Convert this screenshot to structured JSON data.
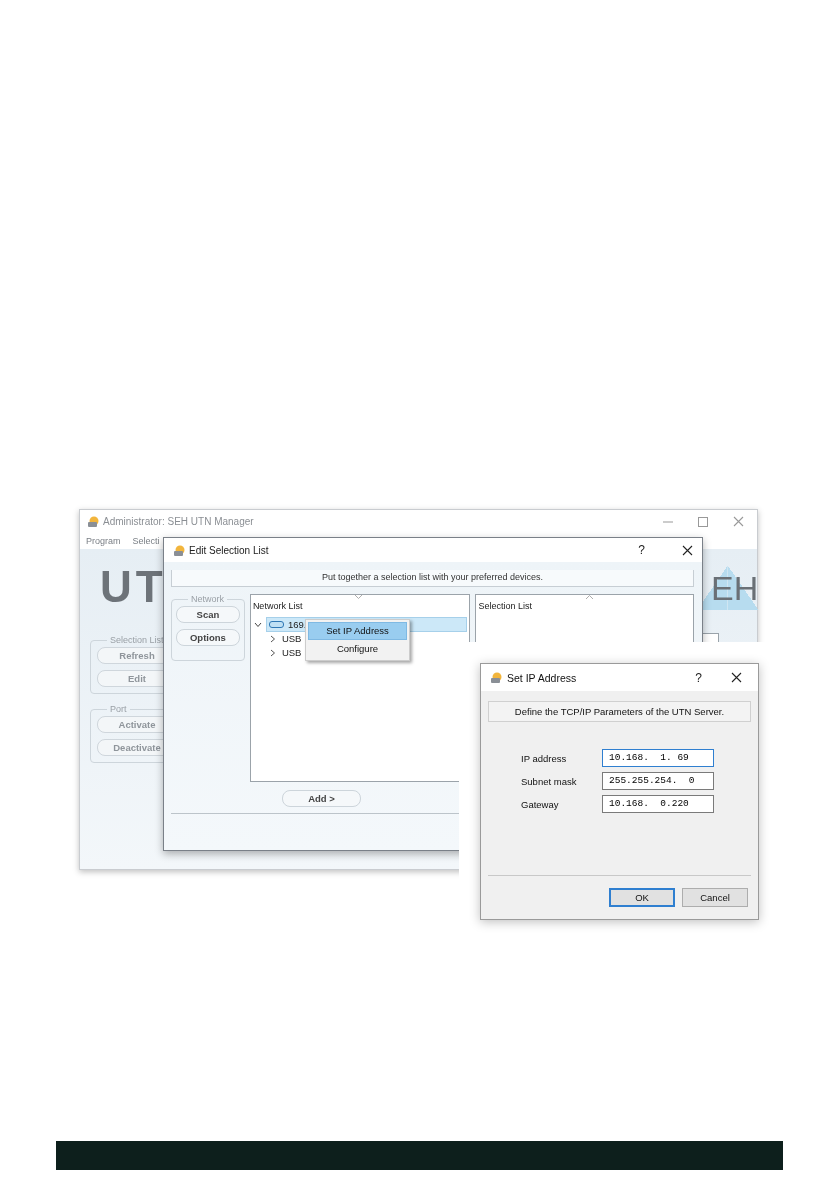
{
  "main_window": {
    "title": "Administrator: SEH UTN Manager",
    "menu": [
      "Program",
      "Selecti"
    ],
    "logo_left": "UT",
    "logo_right": "EH",
    "groups": [
      {
        "legend": "Selection List",
        "buttons": [
          "Refresh",
          "Edit"
        ]
      },
      {
        "legend": "Port",
        "buttons": [
          "Activate",
          "Deactivate"
        ]
      }
    ]
  },
  "edit_dialog": {
    "title": "Edit Selection List",
    "help": "?",
    "intro": "Put together a selection list with your preferred devices.",
    "network_group": {
      "legend": "Network",
      "buttons": [
        "Scan",
        "Options"
      ]
    },
    "network_list": {
      "heading": "Network List",
      "items": [
        {
          "label": "169.",
          "kind": "device",
          "expanded": true,
          "selected": true
        },
        {
          "label": "USB",
          "kind": "port",
          "expanded": false,
          "selected": false
        },
        {
          "label": "USB",
          "kind": "port",
          "expanded": false,
          "selected": false
        }
      ]
    },
    "selection_list": {
      "heading": "Selection List"
    },
    "add_button": "Add >"
  },
  "context_menu": {
    "items": [
      {
        "label": "Set IP Address",
        "selected": true
      },
      {
        "label": "Configure",
        "selected": false
      }
    ]
  },
  "ip_dialog": {
    "title": "Set IP Address",
    "help": "?",
    "intro": "Define the TCP/IP Parameters of the UTN Server.",
    "fields": [
      {
        "label": "IP address",
        "value": "10.168.  1. 69",
        "focused": true
      },
      {
        "label": "Subnet mask",
        "value": "255.255.254.  0",
        "focused": false
      },
      {
        "label": "Gateway",
        "value": "10.168.  0.220",
        "focused": false
      }
    ],
    "buttons": [
      {
        "label": "OK",
        "default": true
      },
      {
        "label": "Cancel",
        "default": false
      }
    ]
  }
}
